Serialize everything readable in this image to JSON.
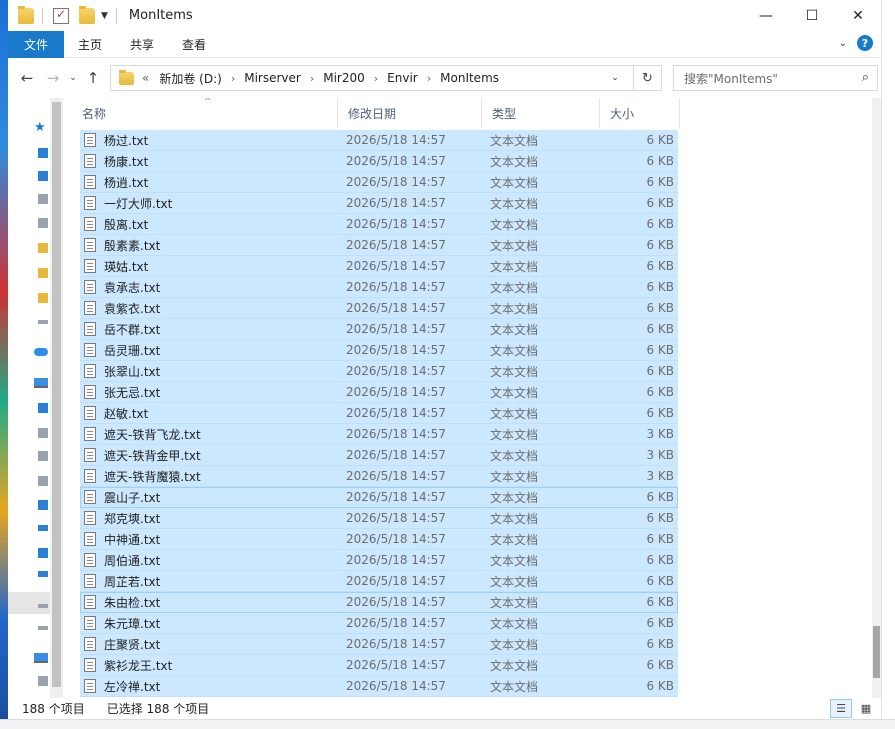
{
  "window": {
    "title": "MonItems",
    "minimize": "—",
    "maximize": "☐",
    "close": "✕"
  },
  "ribbon": {
    "file": "文件",
    "tabs": [
      "主页",
      "共享",
      "查看"
    ],
    "help": "?"
  },
  "nav": {
    "back": "←",
    "forward": "→",
    "recent": "⌄",
    "up": "↑"
  },
  "address": {
    "overflow": "«",
    "crumbs": [
      "新加卷 (D:)",
      "Mirserver",
      "Mir200",
      "Envir",
      "MonItems"
    ],
    "separator": "›",
    "refresh": "↻"
  },
  "search": {
    "placeholder": "搜索\"MonItems\""
  },
  "columns": {
    "name": "名称",
    "date": "修改日期",
    "type": "类型",
    "size": "大小"
  },
  "files": [
    {
      "name": "杨过.txt",
      "date": "2026/5/18 14:57",
      "type": "文本文档",
      "size": "6 KB"
    },
    {
      "name": "杨康.txt",
      "date": "2026/5/18 14:57",
      "type": "文本文档",
      "size": "6 KB"
    },
    {
      "name": "杨逍.txt",
      "date": "2026/5/18 14:57",
      "type": "文本文档",
      "size": "6 KB"
    },
    {
      "name": "一灯大师.txt",
      "date": "2026/5/18 14:57",
      "type": "文本文档",
      "size": "6 KB"
    },
    {
      "name": "殷离.txt",
      "date": "2026/5/18 14:57",
      "type": "文本文档",
      "size": "6 KB"
    },
    {
      "name": "殷素素.txt",
      "date": "2026/5/18 14:57",
      "type": "文本文档",
      "size": "6 KB"
    },
    {
      "name": "瑛姑.txt",
      "date": "2026/5/18 14:57",
      "type": "文本文档",
      "size": "6 KB"
    },
    {
      "name": "袁承志.txt",
      "date": "2026/5/18 14:57",
      "type": "文本文档",
      "size": "6 KB"
    },
    {
      "name": "袁紫衣.txt",
      "date": "2026/5/18 14:57",
      "type": "文本文档",
      "size": "6 KB"
    },
    {
      "name": "岳不群.txt",
      "date": "2026/5/18 14:57",
      "type": "文本文档",
      "size": "6 KB"
    },
    {
      "name": "岳灵珊.txt",
      "date": "2026/5/18 14:57",
      "type": "文本文档",
      "size": "6 KB"
    },
    {
      "name": "张翠山.txt",
      "date": "2026/5/18 14:57",
      "type": "文本文档",
      "size": "6 KB"
    },
    {
      "name": "张无忌.txt",
      "date": "2026/5/18 14:57",
      "type": "文本文档",
      "size": "6 KB"
    },
    {
      "name": "赵敏.txt",
      "date": "2026/5/18 14:57",
      "type": "文本文档",
      "size": "6 KB"
    },
    {
      "name": "遮天-铁背飞龙.txt",
      "date": "2026/5/18 14:57",
      "type": "文本文档",
      "size": "3 KB"
    },
    {
      "name": "遮天-铁背金甲.txt",
      "date": "2026/5/18 14:57",
      "type": "文本文档",
      "size": "3 KB"
    },
    {
      "name": "遮天-铁背魔猿.txt",
      "date": "2026/5/18 14:57",
      "type": "文本文档",
      "size": "3 KB"
    },
    {
      "name": "震山子.txt",
      "date": "2026/5/18 14:57",
      "type": "文本文档",
      "size": "6 KB"
    },
    {
      "name": "郑克塽.txt",
      "date": "2026/5/18 14:57",
      "type": "文本文档",
      "size": "6 KB"
    },
    {
      "name": "中神通.txt",
      "date": "2026/5/18 14:57",
      "type": "文本文档",
      "size": "6 KB"
    },
    {
      "name": "周伯通.txt",
      "date": "2026/5/18 14:57",
      "type": "文本文档",
      "size": "6 KB"
    },
    {
      "name": "周芷若.txt",
      "date": "2026/5/18 14:57",
      "type": "文本文档",
      "size": "6 KB"
    },
    {
      "name": "朱由检.txt",
      "date": "2026/5/18 14:57",
      "type": "文本文档",
      "size": "6 KB"
    },
    {
      "name": "朱元璋.txt",
      "date": "2026/5/18 14:57",
      "type": "文本文档",
      "size": "6 KB"
    },
    {
      "name": "庄聚贤.txt",
      "date": "2026/5/18 14:57",
      "type": "文本文档",
      "size": "6 KB"
    },
    {
      "name": "紫衫龙王.txt",
      "date": "2026/5/18 14:57",
      "type": "文本文档",
      "size": "6 KB"
    },
    {
      "name": "左冷禅.txt",
      "date": "2026/5/18 14:57",
      "type": "文本文档",
      "size": "6 KB"
    }
  ],
  "status": {
    "count": "188 个项目",
    "selected": "已选择 188 个项目"
  },
  "colors": {
    "selection": "#cce8ff",
    "accent": "#1979ca"
  }
}
